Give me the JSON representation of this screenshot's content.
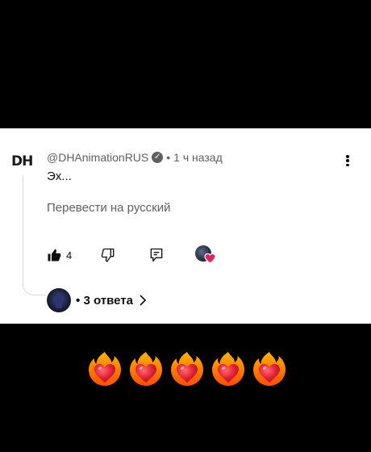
{
  "comment": {
    "logo_text": "DH",
    "author": "@DHAnimationRUS",
    "separator": "•",
    "time": "1 ч назад",
    "text": "Эх...",
    "translate_label": "Перевести на русский",
    "likes": "4",
    "replies_label": "3 ответа"
  },
  "icons": {
    "verified": "verified-check-icon",
    "menu": "more-vertical-icon",
    "like": "thumbs-up-icon",
    "dislike": "thumbs-down-icon",
    "reply": "reply-icon",
    "creator_heart": "creator-heart-icon",
    "chevron": "chevron-right-icon"
  },
  "emoji_row": {
    "emoji": "heart-on-fire-emoji",
    "count": 5
  },
  "colors": {
    "card_bg": "#ffffff",
    "page_bg": "#000000",
    "secondary_text": "#606060",
    "heart_red": "#e0245e"
  }
}
